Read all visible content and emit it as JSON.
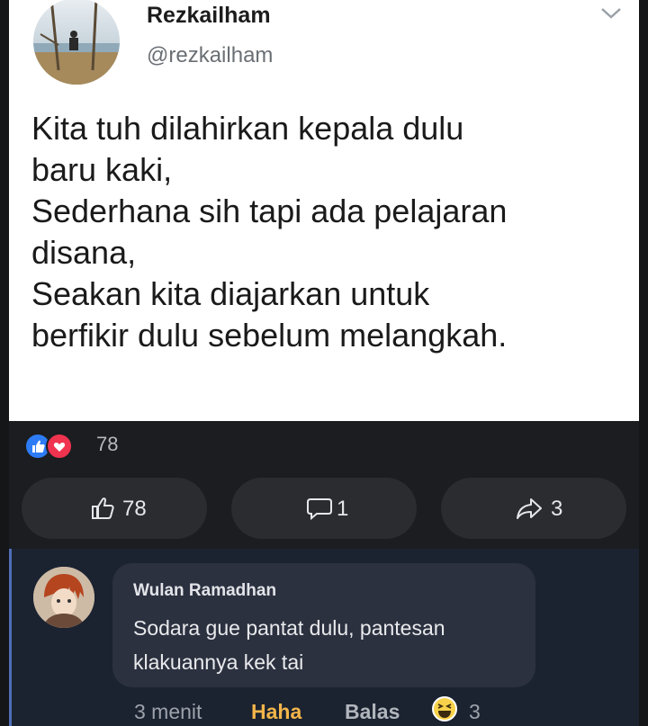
{
  "tweet": {
    "name": "Rezkailham",
    "handle": "@rezkailham",
    "lines": [
      "Kita tuh dilahirkan kepala dulu",
      "baru kaki,",
      "Sederhana sih tapi ada pelajaran",
      "disana,",
      "Seakan kita diajarkan untuk",
      "berfikir dulu sebelum melangkah."
    ]
  },
  "post": {
    "reaction_count": "78",
    "like_count": "78",
    "comment_count": "1",
    "share_count": "3"
  },
  "comment": {
    "author": "Wulan Ramadhan",
    "lines": [
      "Sodara gue pantat dulu, pantesan",
      "klakuannya kek tai"
    ],
    "time": "3 menit",
    "reaction_label": "Haha",
    "reply_label": "Balas",
    "reaction_count": "3"
  },
  "colors": {
    "like_blue": "#2d7cf6",
    "love_red": "#f0334f",
    "haha_yellow": "#f3b54a",
    "dark_bg": "#1b1d20"
  }
}
